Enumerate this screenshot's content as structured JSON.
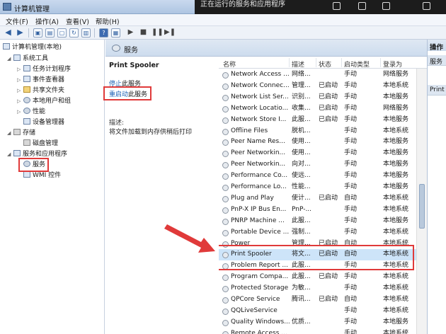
{
  "window": {
    "title": "计算机管理",
    "top_notice": "正在运行的服务和应用程序"
  },
  "menu": [
    "文件(F)",
    "操作(A)",
    "查看(V)",
    "帮助(H)"
  ],
  "tree": {
    "root": "计算机管理(本地)",
    "items": [
      {
        "label": "系统工具",
        "level": 1,
        "expand": "◢"
      },
      {
        "label": "任务计划程序",
        "level": 2,
        "expand": "▷"
      },
      {
        "label": "事件查看器",
        "level": 2,
        "expand": "▷"
      },
      {
        "label": "共享文件夹",
        "level": 2,
        "expand": "▷"
      },
      {
        "label": "本地用户和组",
        "level": 2,
        "expand": "▷"
      },
      {
        "label": "性能",
        "level": 2,
        "expand": "▷"
      },
      {
        "label": "设备管理器",
        "level": 2,
        "expand": ""
      },
      {
        "label": "存储",
        "level": 1,
        "expand": "◢"
      },
      {
        "label": "磁盘管理",
        "level": 2,
        "expand": ""
      },
      {
        "label": "服务和应用程序",
        "level": 1,
        "expand": "◢"
      },
      {
        "label": "服务",
        "level": 2,
        "expand": "",
        "selected": true
      },
      {
        "label": "WMI 控件",
        "level": 2,
        "expand": ""
      }
    ]
  },
  "middle": {
    "header": "服务",
    "selected_name": "Print Spooler",
    "stop_link_a": "停止",
    "stop_link_b": "此服务",
    "restart_link_a": "重启动",
    "restart_link_b": "此服务",
    "desc_caption": "描述:",
    "desc_text": "将文件加载到内存供稍后打印"
  },
  "list": {
    "columns": [
      "名称",
      "描述",
      "状态",
      "启动类型",
      "登录为"
    ],
    "rows": [
      [
        "Network Access ...",
        "网络...",
        "",
        "手动",
        "网络服务"
      ],
      [
        "Network Connec...",
        "管理...",
        "已启动",
        "手动",
        "本地系统"
      ],
      [
        "Network List Ser...",
        "识别...",
        "已启动",
        "手动",
        "本地服务"
      ],
      [
        "Network Locatio...",
        "收集...",
        "已启动",
        "手动",
        "网络服务"
      ],
      [
        "Network Store I...",
        "此服...",
        "已启动",
        "手动",
        "本地服务"
      ],
      [
        "Offline Files",
        "脱机...",
        "",
        "手动",
        "本地系统"
      ],
      [
        "Peer Name Res...",
        "使用...",
        "",
        "手动",
        "本地服务"
      ],
      [
        "Peer Networkin...",
        "使用...",
        "",
        "手动",
        "本地服务"
      ],
      [
        "Peer Networkin...",
        "向对...",
        "",
        "手动",
        "本地服务"
      ],
      [
        "Performance Co...",
        "使远...",
        "",
        "手动",
        "本地服务"
      ],
      [
        "Performance Lo...",
        "性能...",
        "",
        "手动",
        "本地服务"
      ],
      [
        "Plug and Play",
        "使计...",
        "已启动",
        "自动",
        "本地系统"
      ],
      [
        "PnP-X IP Bus En...",
        "PnP-...",
        "",
        "手动",
        "本地系统"
      ],
      [
        "PNRP Machine ...",
        "此服...",
        "",
        "手动",
        "本地服务"
      ],
      [
        "Portable Device ...",
        "强制...",
        "",
        "手动",
        "本地系统"
      ],
      [
        "Power",
        "管理...",
        "已启动",
        "自动",
        "本地系统"
      ],
      [
        "Print Spooler",
        "将文...",
        "已启动",
        "自动",
        "本地系统"
      ],
      [
        "Problem Report ...",
        "此服...",
        "",
        "手动",
        "本地系统"
      ],
      [
        "Program Compa...",
        "此服...",
        "已启动",
        "手动",
        "本地系统"
      ],
      [
        "Protected Storage",
        "为敏...",
        "",
        "手动",
        "本地系统"
      ],
      [
        "QPCore Service",
        "腾讯...",
        "已启动",
        "自动",
        "本地系统"
      ],
      [
        "QQLiveService",
        "",
        "",
        "手动",
        "本地系统"
      ],
      [
        "Quality Windows...",
        "优质...",
        "",
        "手动",
        "本地服务"
      ],
      [
        "Remote Access ...",
        "",
        "",
        "手动",
        "本地系统"
      ]
    ],
    "selected_index": 16
  },
  "ops": {
    "title": "操作",
    "section1": "服务",
    "section2": "Print"
  },
  "colors": {
    "highlight": "#e03a3a",
    "selection": "#cde4f9",
    "link": "#1a5fb4"
  }
}
